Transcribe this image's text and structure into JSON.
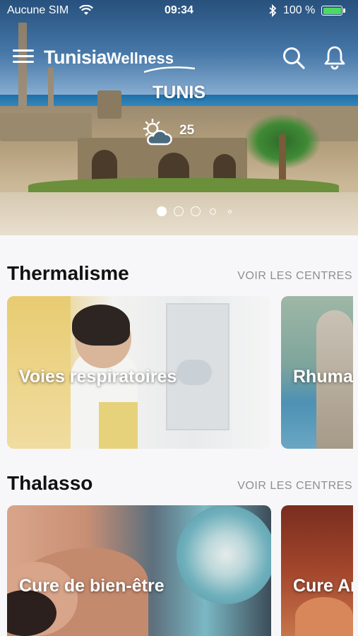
{
  "status_bar": {
    "carrier": "Aucune SIM",
    "time": "09:34",
    "battery_percent": "100 %",
    "battery_color": "#4cd964"
  },
  "header": {
    "logo_part1": "Tunisia",
    "logo_part2": "Wellness",
    "menu_icon": "hamburger-icon",
    "search_icon": "search-icon",
    "notifications_icon": "bell-icon"
  },
  "hero": {
    "city": "TUNIS",
    "weather_icon": "partly-cloudy-icon",
    "temperature": "25",
    "carousel": {
      "count": 5,
      "active_index": 0
    }
  },
  "sections": [
    {
      "title": "Thermalisme",
      "see_all": "VOIR LES CENTRES",
      "cards": [
        {
          "label": "Voies respiratoires"
        },
        {
          "label": "Rhuma"
        }
      ]
    },
    {
      "title": "Thalasso",
      "see_all": "VOIR LES CENTRES",
      "cards": [
        {
          "label": "Cure de bien-être"
        },
        {
          "label": "Cure Ar"
        }
      ]
    }
  ]
}
